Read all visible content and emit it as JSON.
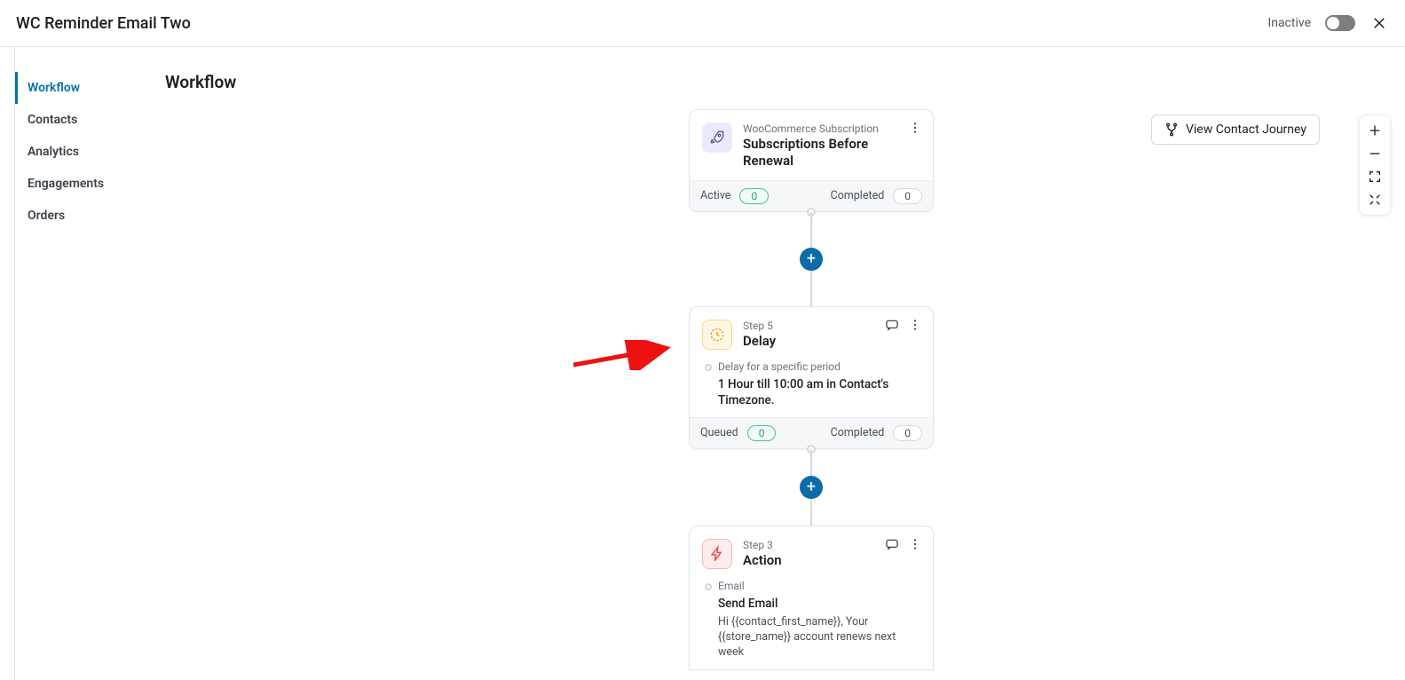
{
  "header": {
    "title": "WC Reminder Email Two",
    "status_label": "Inactive"
  },
  "sidebar": {
    "items": [
      {
        "label": "Workflow",
        "active": true
      },
      {
        "label": "Contacts",
        "active": false
      },
      {
        "label": "Analytics",
        "active": false
      },
      {
        "label": "Engagements",
        "active": false
      },
      {
        "label": "Orders",
        "active": false
      }
    ]
  },
  "page": {
    "heading": "Workflow",
    "journey_button": "View Contact Journey"
  },
  "workflow": {
    "trigger": {
      "category": "WooCommerce Subscription",
      "title": "Subscriptions Before Renewal",
      "active_label": "Active",
      "active_count": "0",
      "completed_label": "Completed",
      "completed_count": "0"
    },
    "delay": {
      "step_label": "Step 5",
      "title": "Delay",
      "sub_category": "Delay for a specific period",
      "sub_title": "1 Hour till 10:00 am in Contact's Timezone.",
      "queued_label": "Queued",
      "queued_count": "0",
      "completed_label": "Completed",
      "completed_count": "0"
    },
    "action": {
      "step_label": "Step 3",
      "title": "Action",
      "sub_category": "Email",
      "sub_title": "Send Email",
      "sub_desc": "Hi {{contact_first_name}}, Your {{store_name}} account renews next week"
    }
  }
}
